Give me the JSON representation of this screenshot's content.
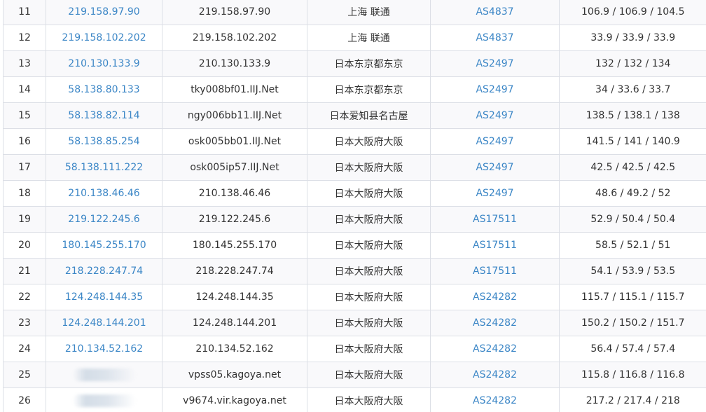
{
  "table": {
    "rows": [
      {
        "hop": "11",
        "ip": "219.158.97.90",
        "host": "219.158.97.90",
        "location": "上海 联通",
        "asn": "AS4837",
        "rtt": "106.9 / 106.9 / 104.5",
        "ip_redacted": false
      },
      {
        "hop": "12",
        "ip": "219.158.102.202",
        "host": "219.158.102.202",
        "location": "上海 联通",
        "asn": "AS4837",
        "rtt": "33.9 / 33.9 / 33.9",
        "ip_redacted": false
      },
      {
        "hop": "13",
        "ip": "210.130.133.9",
        "host": "210.130.133.9",
        "location": "日本东京都东京",
        "asn": "AS2497",
        "rtt": "132 / 132 / 134",
        "ip_redacted": false
      },
      {
        "hop": "14",
        "ip": "58.138.80.133",
        "host": "tky008bf01.IIJ.Net",
        "location": "日本东京都东京",
        "asn": "AS2497",
        "rtt": "34 / 33.6 / 33.7",
        "ip_redacted": false
      },
      {
        "hop": "15",
        "ip": "58.138.82.114",
        "host": "ngy006bb11.IIJ.Net",
        "location": "日本爱知县名古屋",
        "asn": "AS2497",
        "rtt": "138.5 / 138.1 / 138",
        "ip_redacted": false
      },
      {
        "hop": "16",
        "ip": "58.138.85.254",
        "host": "osk005bb01.IIJ.Net",
        "location": "日本大阪府大阪",
        "asn": "AS2497",
        "rtt": "141.5 / 141 / 140.9",
        "ip_redacted": false
      },
      {
        "hop": "17",
        "ip": "58.138.111.222",
        "host": "osk005ip57.IIJ.Net",
        "location": "日本大阪府大阪",
        "asn": "AS2497",
        "rtt": "42.5 / 42.5 / 42.5",
        "ip_redacted": false
      },
      {
        "hop": "18",
        "ip": "210.138.46.46",
        "host": "210.138.46.46",
        "location": "日本大阪府大阪",
        "asn": "AS2497",
        "rtt": "48.6 / 49.2 / 52",
        "ip_redacted": false
      },
      {
        "hop": "19",
        "ip": "219.122.245.6",
        "host": "219.122.245.6",
        "location": "日本大阪府大阪",
        "asn": "AS17511",
        "rtt": "52.9 / 50.4 / 50.4",
        "ip_redacted": false
      },
      {
        "hop": "20",
        "ip": "180.145.255.170",
        "host": "180.145.255.170",
        "location": "日本大阪府大阪",
        "asn": "AS17511",
        "rtt": "58.5 / 52.1 / 51",
        "ip_redacted": false
      },
      {
        "hop": "21",
        "ip": "218.228.247.74",
        "host": "218.228.247.74",
        "location": "日本大阪府大阪",
        "asn": "AS17511",
        "rtt": "54.1 / 53.9 / 53.5",
        "ip_redacted": false
      },
      {
        "hop": "22",
        "ip": "124.248.144.35",
        "host": "124.248.144.35",
        "location": "日本大阪府大阪",
        "asn": "AS24282",
        "rtt": "115.7 / 115.1 / 115.7",
        "ip_redacted": false
      },
      {
        "hop": "23",
        "ip": "124.248.144.201",
        "host": "124.248.144.201",
        "location": "日本大阪府大阪",
        "asn": "AS24282",
        "rtt": "150.2 / 150.2 / 151.7",
        "ip_redacted": false
      },
      {
        "hop": "24",
        "ip": "210.134.52.162",
        "host": "210.134.52.162",
        "location": "日本大阪府大阪",
        "asn": "AS24282",
        "rtt": "56.4 / 57.4 / 57.4",
        "ip_redacted": false
      },
      {
        "hop": "25",
        "ip": "",
        "host": "vpss05.kagoya.net",
        "location": "日本大阪府大阪",
        "asn": "AS24282",
        "rtt": "115.8 / 116.8 / 116.8",
        "ip_redacted": true
      },
      {
        "hop": "26",
        "ip": "",
        "host": "v9674.vir.kagoya.net",
        "location": "日本大阪府大阪",
        "asn": "AS24282",
        "rtt": "217.2 / 217.4 / 218",
        "ip_redacted": true
      }
    ]
  },
  "colors": {
    "link": "#3b86c6",
    "text": "#333333",
    "border": "#dcdfe6",
    "row_alt": "#f9f9fb"
  }
}
